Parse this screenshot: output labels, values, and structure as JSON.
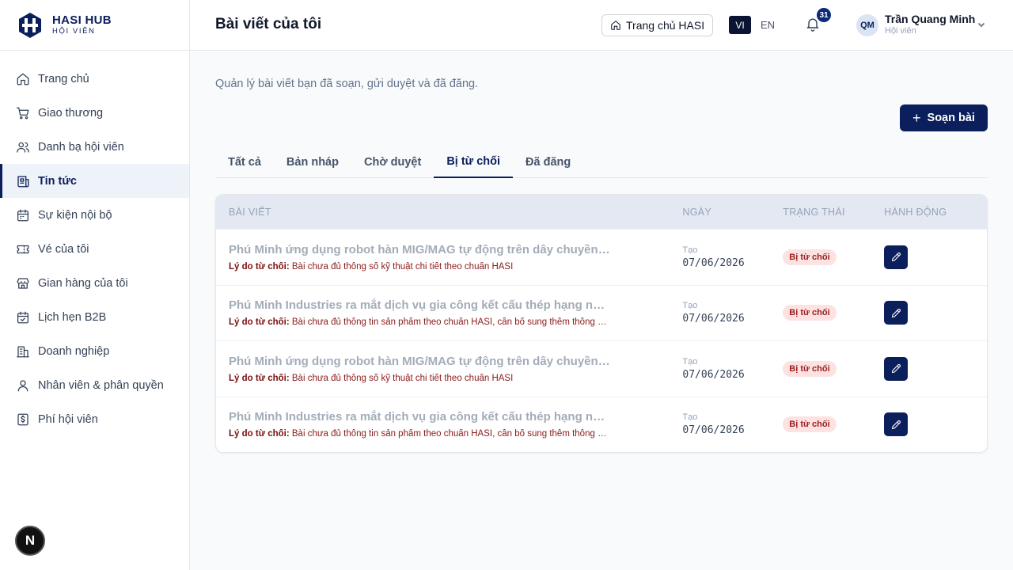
{
  "brand": {
    "name": "HASI HUB",
    "sub": "HỘI VIÊN"
  },
  "sidebar": {
    "items": [
      {
        "label": "Trang chủ",
        "icon": "home-icon"
      },
      {
        "label": "Giao thương",
        "icon": "cart-icon"
      },
      {
        "label": "Danh bạ hội viên",
        "icon": "users-icon"
      },
      {
        "label": "Tin tức",
        "icon": "newspaper-icon",
        "active": true
      },
      {
        "label": "Sự kiện nội bộ",
        "icon": "calendar-icon"
      },
      {
        "label": "Vé của tôi",
        "icon": "ticket-icon"
      },
      {
        "label": "Gian hàng của tôi",
        "icon": "store-icon"
      },
      {
        "label": "Lịch hẹn B2B",
        "icon": "calendar-check-icon"
      },
      {
        "label": "Doanh nghiệp",
        "icon": "building-icon"
      },
      {
        "label": "Nhân viên & phân quyền",
        "icon": "user-icon"
      },
      {
        "label": "Phí hội viên",
        "icon": "receipt-icon"
      }
    ],
    "n_badge": "N"
  },
  "header": {
    "title": "Bài viết của tôi",
    "home_button": "Trang chủ HASI",
    "lang_vi": "VI",
    "lang_en": "EN",
    "notifications": "31",
    "user": {
      "initials": "QM",
      "name": "Trần Quang Minh",
      "role": "Hội viên"
    }
  },
  "main": {
    "subtitle": "Quản lý bài viết bạn đã soạn, gửi duyệt và đã đăng.",
    "compose_label": "Soạn bài",
    "tabs": [
      {
        "label": "Tất cả"
      },
      {
        "label": "Bản nháp"
      },
      {
        "label": "Chờ duyệt"
      },
      {
        "label": "Bị từ chối",
        "active": true
      },
      {
        "label": "Đã đăng"
      }
    ],
    "table": {
      "headers": [
        "BÀI VIẾT",
        "NGÀY",
        "TRẠNG THÁI",
        "HÀNH ĐỘNG"
      ],
      "reason_prefix": "Lý do từ chối:",
      "rows": [
        {
          "title": "Phú Minh ứng dụng robot hàn MIG/MAG tự động trên dây chuyền kết cấu thép",
          "reason": "Bài chưa đủ thông số kỹ thuật chi tiết theo chuẩn HASI",
          "date_label": "Tạo",
          "date": "07/06/2026",
          "status": "Bị từ chối"
        },
        {
          "title": "Phú Minh Industries ra mắt dịch vụ gia công kết cấu thép hạng nặng cho nhà xưởng",
          "reason": "Bài chưa đủ thông tin sản phẩm theo chuẩn HASI, cần bổ sung thêm thông số kỹ thuật",
          "date_label": "Tạo",
          "date": "07/06/2026",
          "status": "Bị từ chối"
        },
        {
          "title": "Phú Minh ứng dụng robot hàn MIG/MAG tự động trên dây chuyền kết cấu thép",
          "reason": "Bài chưa đủ thông số kỹ thuật chi tiết theo chuẩn HASI",
          "date_label": "Tạo",
          "date": "07/06/2026",
          "status": "Bị từ chối"
        },
        {
          "title": "Phú Minh Industries ra mắt dịch vụ gia công kết cấu thép hạng nặng cho nhà xưởng",
          "reason": "Bài chưa đủ thông tin sản phẩm theo chuẩn HASI, cần bổ sung thêm thông số kỹ thuật",
          "date_label": "Tạo",
          "date": "07/06/2026",
          "status": "Bị từ chối"
        }
      ]
    }
  },
  "colors": {
    "brand": "#0b1f5c",
    "reject_badge_bg": "#fde2e2",
    "reject_text": "#8b1a1a"
  }
}
